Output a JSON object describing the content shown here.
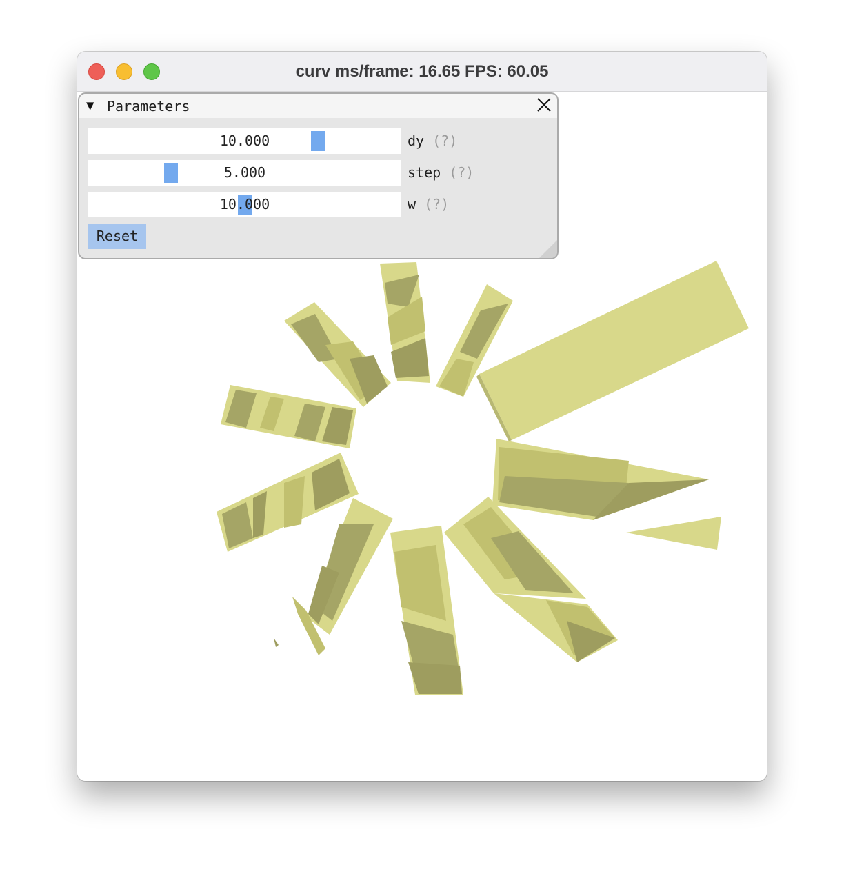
{
  "window": {
    "title": "curv ms/frame: 16.65 FPS: 60.05",
    "buttons": [
      "close",
      "minimize",
      "zoom"
    ]
  },
  "panel": {
    "title": "Parameters",
    "collapse_icon": "triangle-down-icon",
    "close_icon": "close-icon",
    "parameters": [
      {
        "name": "dy",
        "value": "10.000",
        "slider_fraction": 0.73
      },
      {
        "name": "step",
        "value": "5.000",
        "slider_fraction": 0.26
      },
      {
        "name": "w",
        "value": "10.000",
        "slider_fraction": 0.5
      }
    ],
    "help_marker": "(?)",
    "reset_label": "Reset"
  },
  "colors": {
    "titlebar": "#efeff2",
    "panel_bg": "#e6e6e6",
    "slider_grab": "#73a9ee",
    "reset_button": "#a6c5ee",
    "shape_light": "#d8d88a",
    "shape_mid": "#c1c06f",
    "shape_dark": "#9e9d5f"
  }
}
